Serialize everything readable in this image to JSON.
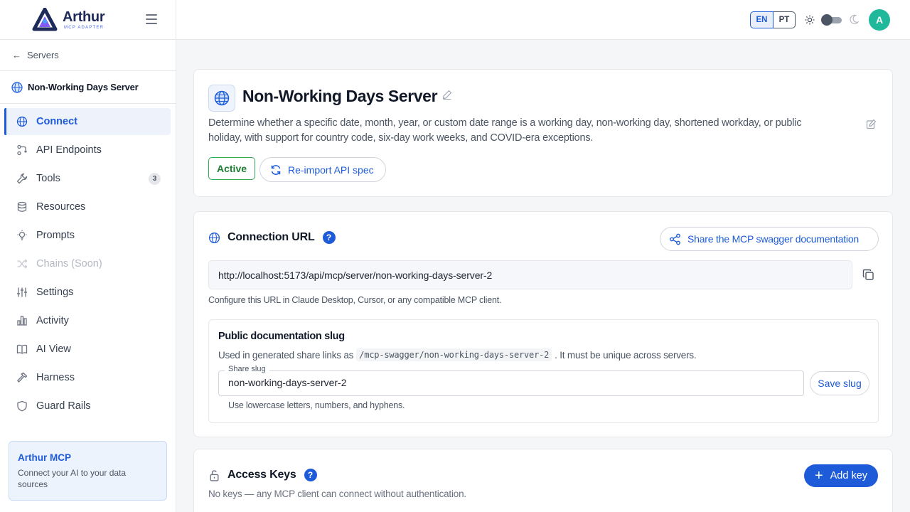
{
  "brand": {
    "name": "Arthur",
    "subtitle": "MCP ADAPTER"
  },
  "sidebar": {
    "back_label": "Servers",
    "server_name": "Non-Working Days Server",
    "items": [
      {
        "label": "Connect",
        "icon": "globe-icon",
        "active": true
      },
      {
        "label": "API Endpoints",
        "icon": "endpoints-icon"
      },
      {
        "label": "Tools",
        "icon": "wrench-icon",
        "badge": "3"
      },
      {
        "label": "Resources",
        "icon": "database-icon"
      },
      {
        "label": "Prompts",
        "icon": "lightbulb-icon"
      },
      {
        "label": "Chains (Soon)",
        "icon": "shuffle-icon",
        "disabled": true
      },
      {
        "label": "Settings",
        "icon": "sliders-icon"
      },
      {
        "label": "Activity",
        "icon": "bar-chart-icon"
      },
      {
        "label": "AI View",
        "icon": "book-icon"
      },
      {
        "label": "Harness",
        "icon": "hammer-icon"
      },
      {
        "label": "Guard Rails",
        "icon": "shield-icon"
      }
    ],
    "promo": {
      "title": "Arthur MCP",
      "text": "Connect your AI to your data sources"
    }
  },
  "topbar": {
    "lang_en": "EN",
    "lang_pt": "PT",
    "avatar_initial": "A"
  },
  "server": {
    "title": "Non-Working Days Server",
    "description": "Determine whether a specific date, month, year, or custom date range is a working day, non-working day, shortened workday, or public holiday, with support for country code, six-day work weeks, and COVID-era exceptions.",
    "status": "Active",
    "reimport_label": "Re-import API spec"
  },
  "connection": {
    "title": "Connection URL",
    "help": "?",
    "share_label": "Share the MCP swagger documentation",
    "url": "http://localhost:5173/api/mcp/server/non-working-days-server-2",
    "help_text": "Configure this URL in Claude Desktop, Cursor, or any compatible MCP client.",
    "slug": {
      "title": "Public documentation slug",
      "desc_before": "Used in generated share links as",
      "desc_code": "/mcp-swagger/non-working-days-server-2",
      "desc_after": ". It must be unique across servers.",
      "input_label": "Share slug",
      "input_value": "non-working-days-server-2",
      "save_label": "Save slug",
      "hint": "Use lowercase letters, numbers, and hyphens."
    }
  },
  "access_keys": {
    "title": "Access Keys",
    "help": "?",
    "add_label": "Add key",
    "empty_text": "No keys — any MCP client can connect without authentication."
  },
  "colors": {
    "accent": "#1e5bd8",
    "success": "#34a853",
    "avatar": "#1fb89a"
  }
}
